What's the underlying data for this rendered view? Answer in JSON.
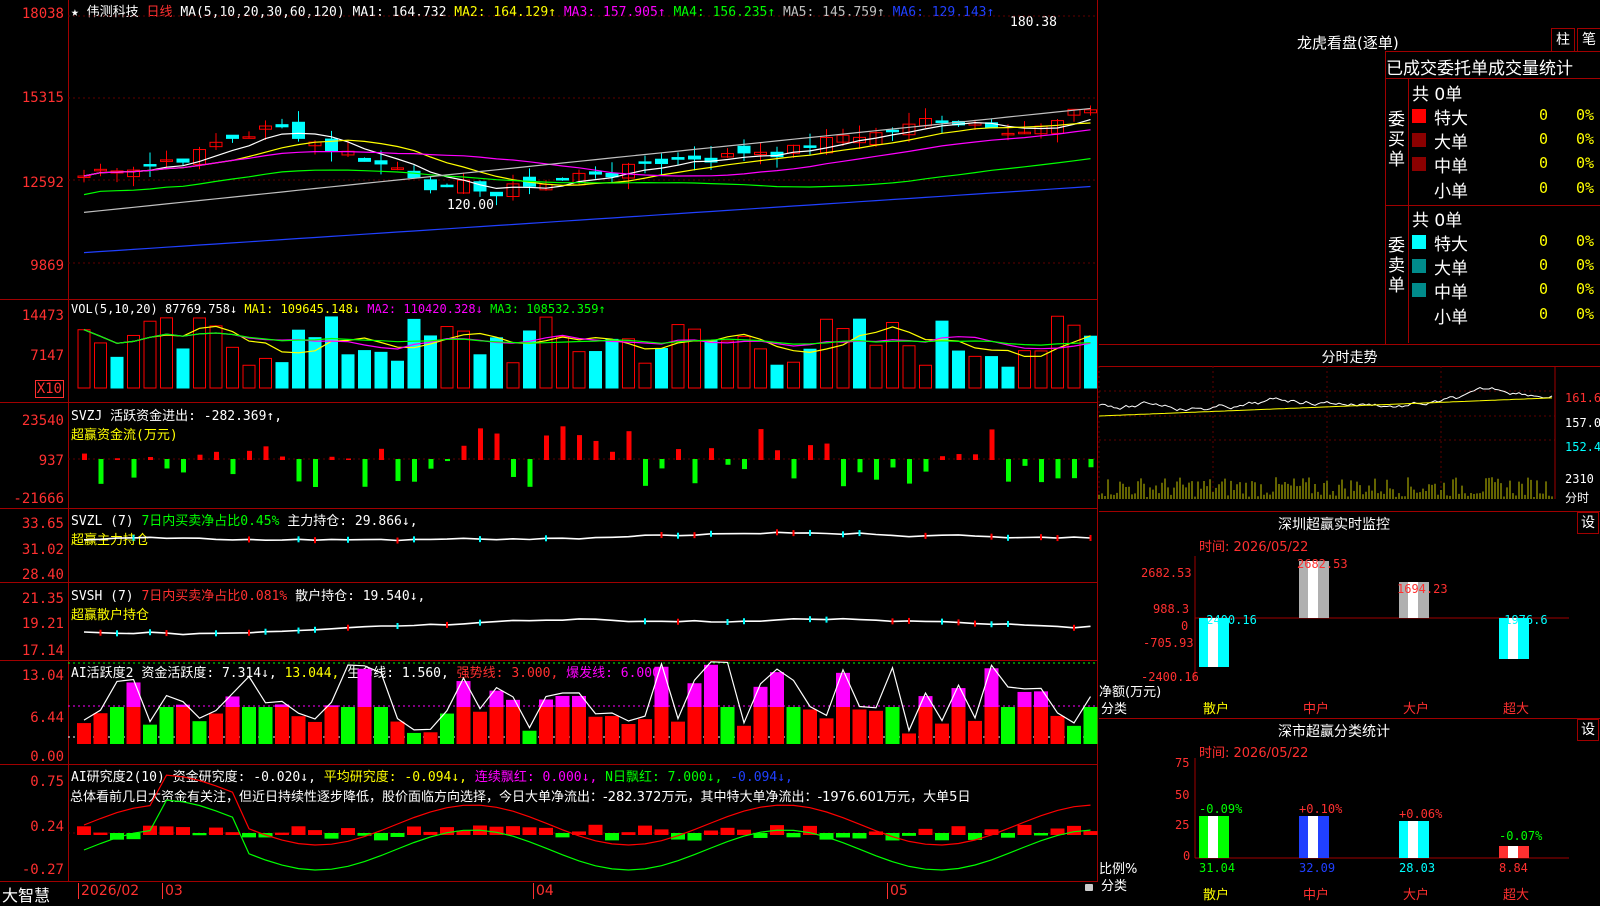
{
  "kline": {
    "name": "★ 伟测科技",
    "period": "日线",
    "ma_params": "MA(5,10,20,30,60,120)",
    "ma1": "MA1: 164.732",
    "ma2": "MA2: 164.129↑",
    "ma3": "MA3: 157.905↑",
    "ma4": "MA4: 156.235↑",
    "ma5": "MA5: 145.759↑",
    "ma6": "MA6: 129.143↑",
    "axis": [
      "18038",
      "15315",
      "12592",
      "9869"
    ],
    "high_mark": "180.38",
    "low_mark": "120.00"
  },
  "vol": {
    "label": "VOL(5,10,20)",
    "value": "87769.758↓",
    "ma1": "MA1: 109645.148↓",
    "ma2": "MA2: 110420.328↓",
    "ma3": "MA3: 108532.359↑",
    "axis": [
      "14473",
      "7147"
    ],
    "unit": "X10"
  },
  "svzj": {
    "label": "SVZJ",
    "value": "活跃资金进出: -282.369↑,",
    "sub": "超赢资金流(万元)",
    "axis": [
      "23540",
      "937",
      "-21666"
    ]
  },
  "svzl": {
    "label": "SVZL (7)",
    "ratio": "7日内买卖净占比0.45%",
    "hold": "主力持仓: 29.866↓,",
    "sub": "超赢主力持仓",
    "axis": [
      "33.65",
      "31.02",
      "28.40"
    ]
  },
  "svsh": {
    "label": "SVSH (7)",
    "ratio": "7日内买卖净占比0.081%",
    "hold": "散户持仓: 19.540↓,",
    "sub": "超赢散户持仓",
    "axis": [
      "21.35",
      "19.21",
      "17.14"
    ]
  },
  "ai1": {
    "label": "AI活跃度2",
    "act": "资金活跃度: 7.314↓,",
    "v2": "13.044,",
    "life": "生命线: 1.560,",
    "strong": "强势线: 3.000,",
    "burst": "爆发线: 6.000,",
    "axis": [
      "13.04",
      "6.44",
      "0.00"
    ]
  },
  "ai2": {
    "label": "AI研究度2(10)",
    "study": "资金研究度: -0.020↓,",
    "avg": "平均研究度: -0.094↓,",
    "red": "连续飘红: 0.000↓,",
    "nred": "N日飘红: 7.000↓,",
    "last": "-0.094↓,",
    "note": "总体看前几日大资金有关注，但近日持续性逐步降低，股价面临方向选择，今日大单净流出：-282.372万元，其中特大单净流出：-1976.601万元，大单5日",
    "axis": [
      "0.75",
      "0.24",
      "-0.27"
    ]
  },
  "bottom": {
    "brand": "大智慧",
    "dates": [
      "2026/02",
      "03",
      "04",
      "05"
    ]
  },
  "longhu": {
    "title": "龙虎看盘(逐单)",
    "btn1": "柱",
    "btn2": "笔",
    "tabs": "已成交委托单成交量统计",
    "buy_label": "委买单",
    "sell_label": "委卖单",
    "buy_total": "共 0单",
    "sell_total": "共 0单",
    "buy_rows": [
      {
        "name": "特大",
        "count": "0",
        "pct": "0%"
      },
      {
        "name": "大单",
        "count": "0",
        "pct": "0%"
      },
      {
        "name": "中单",
        "count": "0",
        "pct": "0%"
      },
      {
        "name": "小单",
        "count": "0",
        "pct": "0%"
      }
    ],
    "sell_rows": [
      {
        "name": "特大",
        "count": "0",
        "pct": "0%"
      },
      {
        "name": "大单",
        "count": "0",
        "pct": "0%"
      },
      {
        "name": "中单",
        "count": "0",
        "pct": "0%"
      },
      {
        "name": "小单",
        "count": "0",
        "pct": "0%"
      }
    ],
    "buy_colors": [
      "#ff0000",
      "#8b0000",
      "#8b0000",
      "#000000"
    ],
    "sell_colors": [
      "#00ffff",
      "#008b8b",
      "#008b8b",
      "#000000"
    ]
  },
  "fenshi": {
    "title": "分时走势",
    "axis": [
      "161.6",
      "157.0",
      "152.4"
    ],
    "vol": "2310",
    "unit": "分时"
  },
  "sz_monitor": {
    "title": "深圳超赢实时监控",
    "set_btn": "设",
    "time": "时间: 2026/05/22",
    "axis": [
      "2682.53",
      "988.3",
      "0",
      "-705.93",
      "-2400.16"
    ],
    "bar_labels": [
      "-2400.16",
      "2682.53",
      "1694.23",
      "-1976.6"
    ],
    "categories": [
      "散户",
      "中户",
      "大户",
      "超大"
    ],
    "y_title": "净额(万元)",
    "x_title": "分类"
  },
  "sz_class": {
    "title": "深市超赢分类统计",
    "set_btn": "设",
    "time": "时间: 2026/05/22",
    "axis": [
      "75",
      "50",
      "25",
      "0"
    ],
    "changes": [
      "-0.09%",
      "+0.10%",
      "+0.06%",
      "-0.07%"
    ],
    "values": [
      "31.04",
      "32.09",
      "28.03",
      "8.84"
    ],
    "categories": [
      "散户",
      "中户",
      "大户",
      "超大"
    ],
    "y_title": "比例%",
    "x_title": "分类"
  },
  "colors": {
    "up": "#ff0000",
    "down": "#00ffff",
    "grid": "#a00000",
    "axis_text": "#ff3030",
    "yellow": "#ffff00",
    "magenta": "#ff00ff",
    "green": "#00ff00"
  }
}
